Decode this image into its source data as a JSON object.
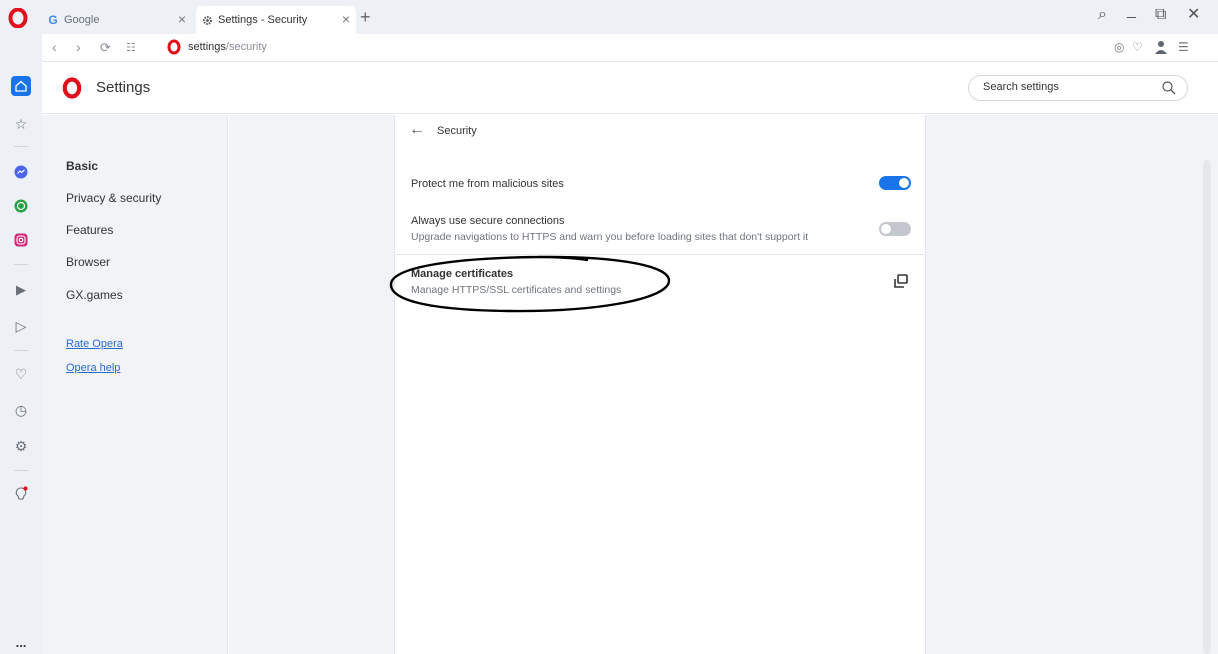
{
  "browser": {
    "tabs": [
      {
        "label": "Google",
        "favicon_letter": "G"
      },
      {
        "label": "Settings - Security"
      }
    ],
    "close_glyph": "×",
    "new_tab_glyph": "+",
    "window_controls": {
      "search": "⌕",
      "minimize": "_",
      "restore": "⧉",
      "close": "✕"
    }
  },
  "address_bar": {
    "host": "settings",
    "path": "/security"
  },
  "sidebar": {
    "items": [
      {
        "icon": "home-icon"
      },
      {
        "icon": "bookmarks-icon"
      },
      {
        "icon": "messenger-icon"
      },
      {
        "icon": "whatsapp-icon"
      },
      {
        "icon": "instagram-icon"
      },
      {
        "icon": "player-icon"
      },
      {
        "icon": "send-icon"
      },
      {
        "icon": "heart-icon"
      },
      {
        "icon": "history-icon"
      },
      {
        "icon": "settings-icon"
      },
      {
        "icon": "tips-icon"
      }
    ],
    "more_label": "..."
  },
  "settings": {
    "title": "Settings",
    "search_placeholder": "Search settings"
  },
  "nav": {
    "items": [
      "Basic",
      "Privacy & security",
      "Features",
      "Browser",
      "GX.games"
    ],
    "links": [
      "Rate Opera",
      "Opera help"
    ]
  },
  "security": {
    "section_title": "Security",
    "rows": [
      {
        "title": "Protect me from malicious sites",
        "enabled": true
      },
      {
        "title": "Always use secure connections",
        "subtitle": "Upgrade navigations to HTTPS and warn you before loading sites that don't support it",
        "enabled": false
      },
      {
        "title": "Manage certificates",
        "subtitle": "Manage HTTPS/SSL certificates and settings"
      }
    ]
  },
  "colors": {
    "accent": "#1a73e8",
    "toggle_off": "#c4c8ce",
    "opera_red": "#e0111d",
    "sidebar_bg": "#edf0f5"
  }
}
